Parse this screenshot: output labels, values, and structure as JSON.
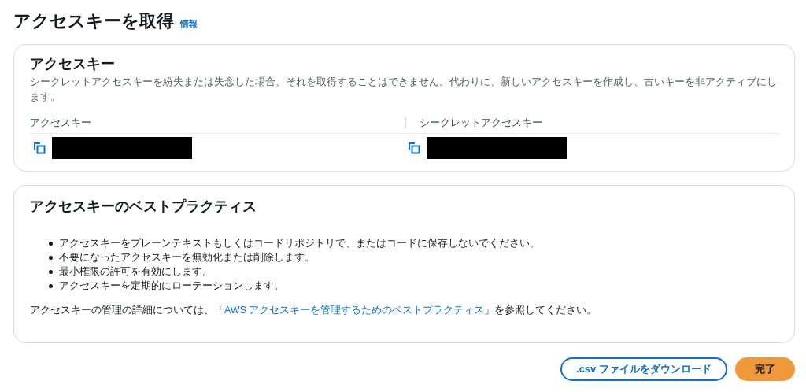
{
  "page": {
    "title": "アクセスキーを取得",
    "info_link": "情報"
  },
  "access_key_card": {
    "title": "アクセスキー",
    "description": "シークレットアクセスキーを紛失または失念した場合、それを取得することはできません。代わりに、新しいアクセスキーを作成し、古いキーを非アクティブにします。",
    "columns": [
      {
        "heading": "アクセスキー"
      },
      {
        "heading": "シークレットアクセスキー"
      }
    ]
  },
  "best_practices_card": {
    "title": "アクセスキーのベストプラクティス",
    "items": [
      "アクセスキーをプレーンテキストもしくはコードリポジトリで、またはコードに保存しないでください。",
      "不要になったアクセスキーを無効化または削除します。",
      "最小権限の許可を有効にします。",
      "アクセスキーを定期的にローテーションします。"
    ],
    "note": {
      "before": "アクセスキーの管理の詳細については、「",
      "link": "AWS アクセスキーを管理するためのベストプラクティス",
      "after": "」を参照してください。"
    }
  },
  "buttons": [
    {
      "label": ".csv ファイルをダウンロード",
      "kind": "secondary"
    },
    {
      "label": "完了",
      "kind": "primary"
    }
  ]
}
